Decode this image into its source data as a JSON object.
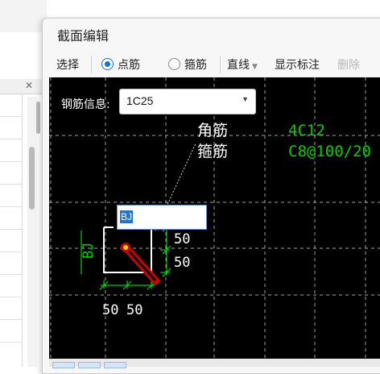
{
  "dialog": {
    "title": "截面编辑",
    "toolbar": {
      "select_label": "选择",
      "point_rebar_label": "点筋",
      "stirrup_label": "箍筋",
      "line_label": "直线",
      "show_annotation_label": "显示标注",
      "delete_label": "删除"
    }
  },
  "rebar_info": {
    "label": "钢筋信息:",
    "value": "1C25"
  },
  "canvas": {
    "corner_bar_label": "角筋",
    "stirrup_bar_label": "箍筋",
    "corner_bar_value": "4C12",
    "stirrup_value": "C8@100/20",
    "side_label": "BJ",
    "edit_value": "BJ",
    "dim_right_top": "50",
    "dim_right_bottom": "50",
    "dim_bottom_left": "50",
    "dim_bottom_right": "50"
  },
  "colors": {
    "canvas_bg": "#000000",
    "grid": "#a0a0a0",
    "annotation_green": "#00d000",
    "section_white": "#ffffff",
    "rebar_red": "#d00000",
    "selection_blue": "#1e73d8"
  },
  "icons": {
    "radio_on": "radio-checked-icon",
    "radio_off": "radio-unchecked-icon",
    "dropdown": "caret-down-icon"
  }
}
